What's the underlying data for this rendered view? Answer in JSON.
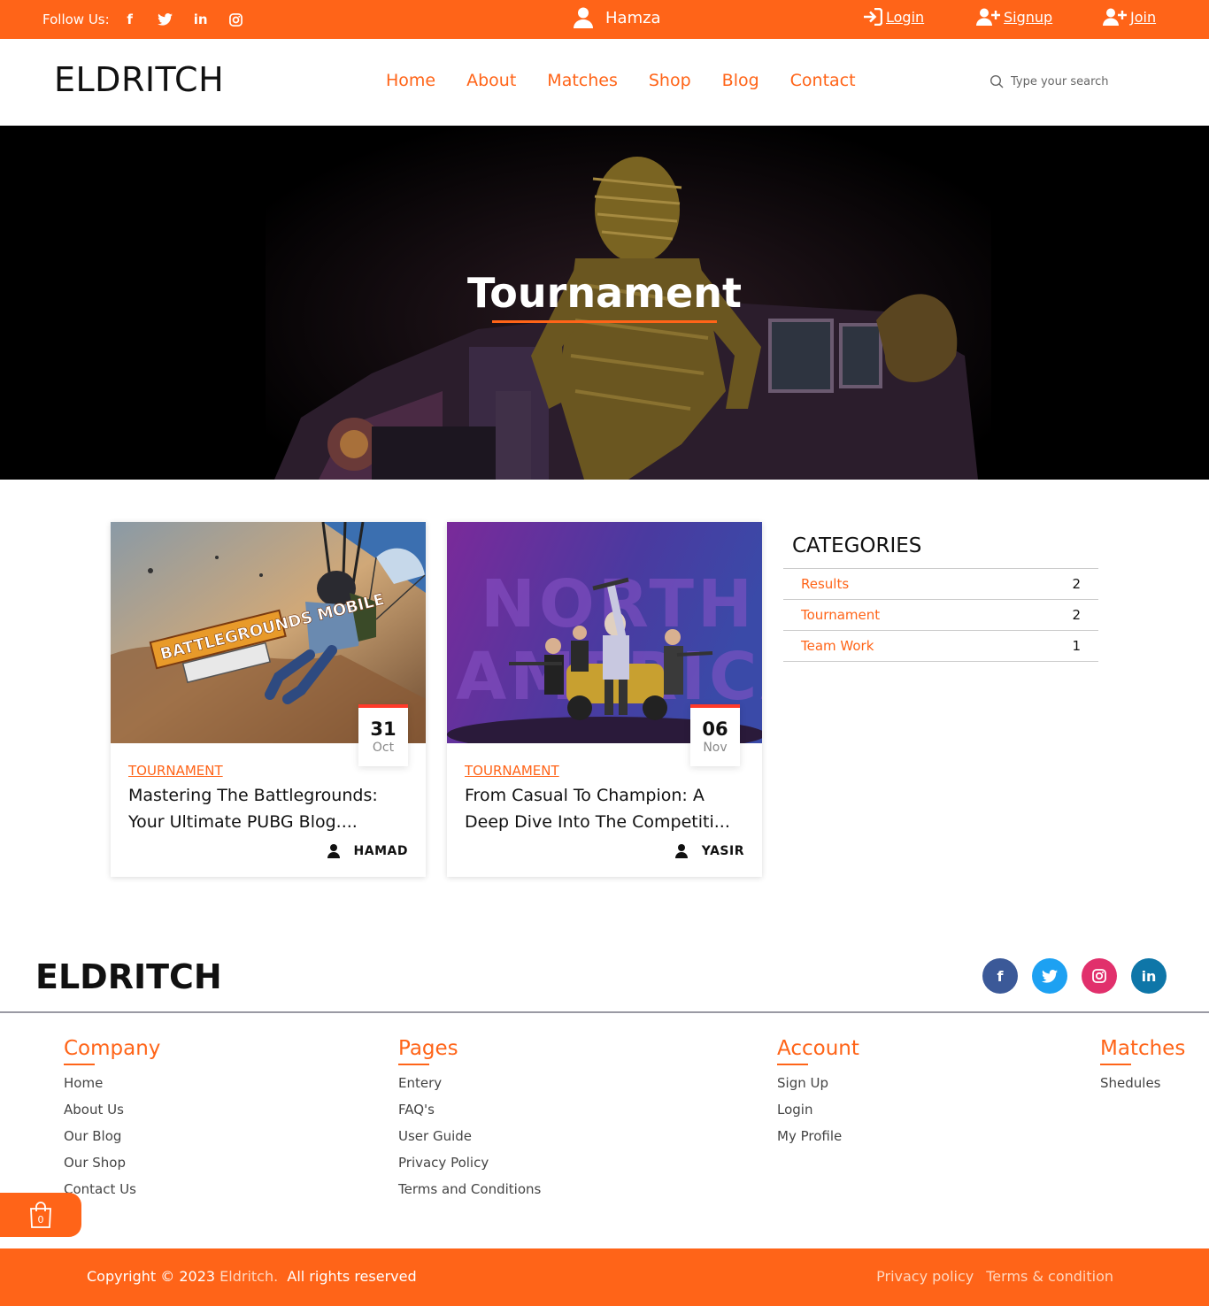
{
  "topbar": {
    "follow_label": "Follow Us:",
    "socials": [
      "f",
      "twitter",
      "in",
      "instagram"
    ],
    "username": "Hamza",
    "login": "Login",
    "signup": "Signup",
    "join": "Join"
  },
  "header": {
    "logo": "ELDRITCH",
    "nav": [
      "Home",
      "About",
      "Matches",
      "Shop",
      "Blog",
      "Contact"
    ],
    "search_placeholder": "Type your search"
  },
  "hero": {
    "title": "Tournament"
  },
  "posts": [
    {
      "day": "31",
      "month": "Oct",
      "category": "TOURNAMENT",
      "title": "Mastering The Battlegrounds: Your Ultimate PUBG Blog....",
      "author": "HAMAD",
      "image_text": "BATTLEGROUNDS MOBILE"
    },
    {
      "day": "06",
      "month": "Nov",
      "category": "TOURNAMENT",
      "title": "From Casual To Champion: A Deep Dive Into The Competiti...",
      "author": "YASIR",
      "image_text": "NORTH AMERICA"
    }
  ],
  "categories": {
    "heading": "CATEGORIES",
    "items": [
      {
        "name": "Results",
        "count": "2"
      },
      {
        "name": "Tournament",
        "count": "2"
      },
      {
        "name": "Team Work",
        "count": "1"
      }
    ]
  },
  "footer": {
    "logo": "ELDRITCH",
    "social_colors": {
      "facebook": "#3b5998",
      "twitter": "#1da1f2",
      "instagram": "#e1306c",
      "linkedin": "#0e76a8"
    },
    "columns": [
      {
        "title": "Company",
        "links": [
          "Home",
          "About Us",
          "Our Blog",
          "Our Shop",
          "Contact Us"
        ]
      },
      {
        "title": "Pages",
        "links": [
          "Entery",
          "FAQ's",
          "User Guide",
          "Privacy Policy",
          "Terms and Conditions"
        ]
      },
      {
        "title": "Account",
        "links": [
          "Sign Up",
          "Login",
          "My Profile"
        ]
      },
      {
        "title": "Matches",
        "links": [
          "Shedules"
        ]
      }
    ],
    "cart_count": "0",
    "copyright_prefix": "Copyright © 2023",
    "copyright_brand": "Eldritch.",
    "copyright_suffix": "All rights reserved",
    "privacy": "Privacy policy",
    "terms": "Terms & condition"
  },
  "colors": {
    "accent": "#ff6418",
    "date_top": "#ff3a2a"
  }
}
